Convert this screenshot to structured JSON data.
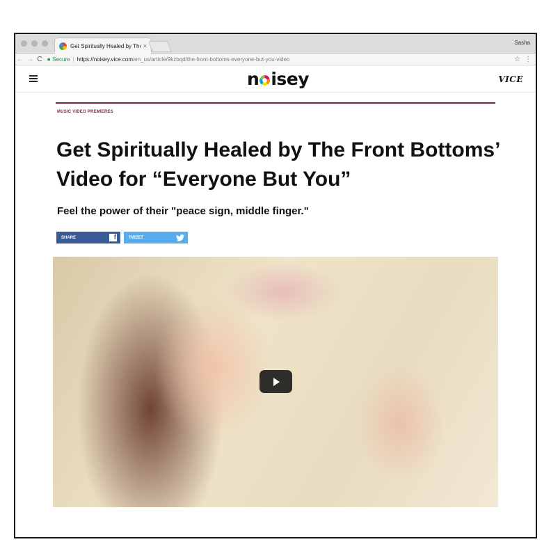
{
  "browser": {
    "tab_title": "Get Spiritually Healed by The F",
    "tab_close": "×",
    "profile_name": "Sasha",
    "back_icon": "←",
    "forward_icon": "→",
    "reload_icon": "C",
    "secure_label": "Secure",
    "url_host": "https://noisey.vice.com",
    "url_path": "/en_us/article/9kzbqd/the-front-bottoms-everyone-but-you-video",
    "star_icon": "☆",
    "menu_icon": "⋮"
  },
  "site": {
    "logo_prefix": "n",
    "logo_suffix": "isey",
    "vice_logo": "VICE",
    "brand_color": "#7a2b3a"
  },
  "article": {
    "kicker": "MUSIC VIDEO PREMIERES",
    "headline": "Get Spiritually Healed by The Front Bottoms’ Video for “Everyone But You”",
    "dek": "Feel the power of their \"peace sign, middle finger.\"",
    "share_label": "SHARE",
    "tweet_label": "TWEET",
    "facebook_color": "#3b5a98",
    "twitter_color": "#55acee"
  },
  "video": {
    "play_icon": "play-icon"
  }
}
